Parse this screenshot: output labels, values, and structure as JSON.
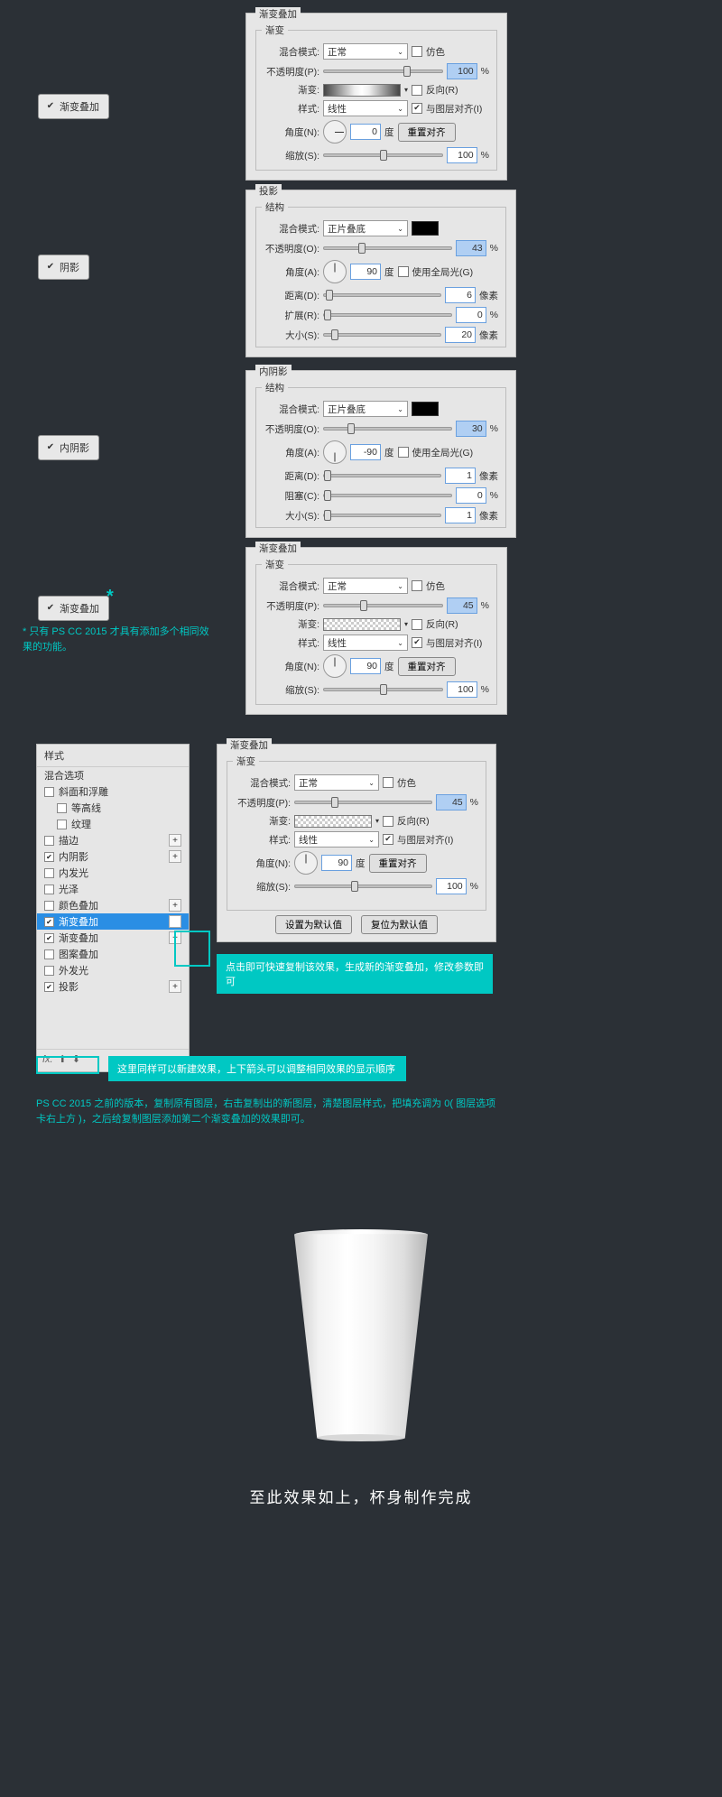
{
  "buttons": {
    "gradient_overlay": "渐变叠加",
    "shadow": "阴影",
    "inner_shadow": "内阴影"
  },
  "note1": "* 只有 PS CC 2015 才具有添加多个相同效果的功能。",
  "panel_gradient1": {
    "title": "渐变叠加",
    "group_title": "渐变",
    "blend_mode_label": "混合模式:",
    "blend_mode_value": "正常",
    "dither_label": "仿色",
    "opacity_label": "不透明度(P):",
    "opacity_value": "100",
    "percent": "%",
    "gradient_label": "渐变:",
    "reverse_label": "反向(R)",
    "style_label": "样式:",
    "style_value": "线性",
    "align_label": "与图层对齐(I)",
    "angle_label": "角度(N):",
    "angle_value": "0",
    "degree": "度",
    "reset_btn": "重置对齐",
    "scale_label": "缩放(S):",
    "scale_value": "100"
  },
  "panel_shadow": {
    "title": "投影",
    "group_title": "结构",
    "blend_mode_label": "混合模式:",
    "blend_mode_value": "正片叠底",
    "opacity_label": "不透明度(O):",
    "opacity_value": "43",
    "percent": "%",
    "angle_label": "角度(A):",
    "angle_value": "90",
    "degree": "度",
    "global_label": "使用全局光(G)",
    "distance_label": "距离(D):",
    "distance_value": "6",
    "px": "像素",
    "spread_label": "扩展(R):",
    "spread_value": "0",
    "size_label": "大小(S):",
    "size_value": "20"
  },
  "panel_inner_shadow": {
    "title": "内阴影",
    "group_title": "结构",
    "blend_mode_label": "混合模式:",
    "blend_mode_value": "正片叠底",
    "opacity_label": "不透明度(O):",
    "opacity_value": "30",
    "percent": "%",
    "angle_label": "角度(A):",
    "angle_value": "-90",
    "degree": "度",
    "global_label": "使用全局光(G)",
    "distance_label": "距离(D):",
    "distance_value": "1",
    "px": "像素",
    "choke_label": "阻塞(C):",
    "choke_value": "0",
    "size_label": "大小(S):",
    "size_value": "1"
  },
  "panel_gradient2": {
    "title": "渐变叠加",
    "group_title": "渐变",
    "blend_mode_label": "混合模式:",
    "blend_mode_value": "正常",
    "dither_label": "仿色",
    "opacity_label": "不透明度(P):",
    "opacity_value": "45",
    "percent": "%",
    "gradient_label": "渐变:",
    "reverse_label": "反向(R)",
    "style_label": "样式:",
    "style_value": "线性",
    "align_label": "与图层对齐(I)",
    "angle_label": "角度(N):",
    "angle_value": "90",
    "degree": "度",
    "reset_btn": "重置对齐",
    "scale_label": "缩放(S):",
    "scale_value": "100"
  },
  "styles_panel": {
    "header": "样式",
    "blend_options": "混合选项",
    "bevel": "斜面和浮雕",
    "contour": "等高线",
    "texture": "纹理",
    "stroke": "描边",
    "inner_shadow": "内阴影",
    "inner_glow": "内发光",
    "satin": "光泽",
    "color_overlay": "颜色叠加",
    "gradient_overlay": "渐变叠加",
    "gradient_overlay2": "渐变叠加",
    "pattern_overlay": "图案叠加",
    "outer_glow": "外发光",
    "drop_shadow": "投影",
    "fx": "fx."
  },
  "panel_gradient3": {
    "title": "渐变叠加",
    "group_title": "渐变",
    "blend_mode_label": "混合模式:",
    "blend_mode_value": "正常",
    "dither_label": "仿色",
    "opacity_label": "不透明度(P):",
    "opacity_value": "45",
    "percent": "%",
    "gradient_label": "渐变:",
    "reverse_label": "反向(R)",
    "style_label": "样式:",
    "style_value": "线性",
    "align_label": "与图层对齐(I)",
    "angle_label": "角度(N):",
    "angle_value": "90",
    "degree": "度",
    "reset_btn": "重置对齐",
    "scale_label": "缩放(S):",
    "scale_value": "100",
    "set_default": "设置为默认值",
    "reset_default": "复位为默认值"
  },
  "callout1": "点击即可快速复制该效果，生成新的渐变叠加，修改参数即可",
  "callout2": "这里同样可以新建效果，上下箭头可以调整相同效果的显示顺序",
  "note2": "PS CC 2015 之前的版本，复制原有图层，右击复制出的新图层，清楚图层样式，把填充调为 0( 图层选项卡右上方 )，之后给复制图层添加第二个渐变叠加的效果即可。",
  "final": "至此效果如上，杯身制作完成"
}
